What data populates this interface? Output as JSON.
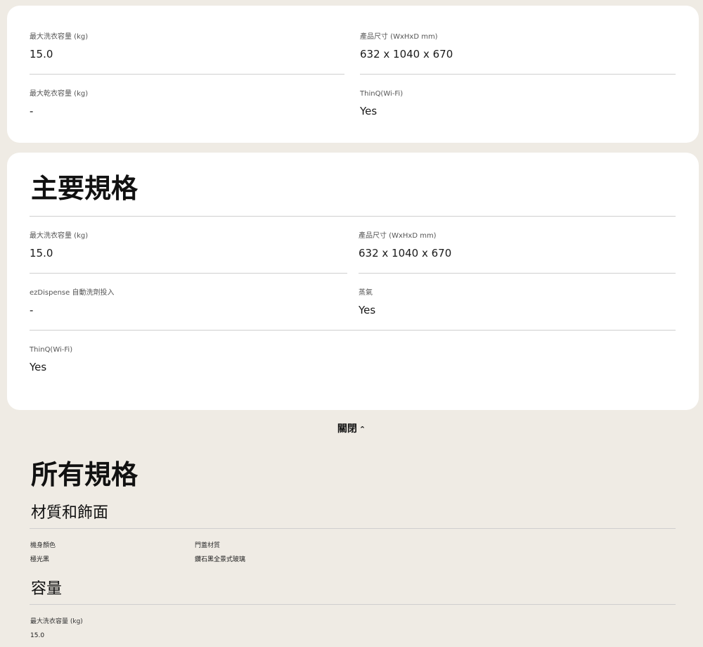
{
  "summary": {
    "max_wash_label": "最大洗衣容量 (kg)",
    "max_wash_value": "15.0",
    "size_label": "產品尺寸 (WxHxD mm)",
    "size_value": "632 x 1040 x 670",
    "max_dry_label": "最大乾衣容量 (kg)",
    "max_dry_value": "-",
    "thinq_label": "ThinQ(Wi-Fi)",
    "thinq_value": "Yes"
  },
  "key_specs": {
    "title": "主要規格",
    "max_wash_label": "最大洗衣容量 (kg)",
    "max_wash_value": "15.0",
    "size_label": "產品尺寸 (WxHxD mm)",
    "size_value": "632 x 1040 x 670",
    "ezdispense_label": "ezDispense 自動洗劑投入",
    "ezdispense_value": "-",
    "steam_label": "蒸氣",
    "steam_value": "Yes",
    "thinq_label": "ThinQ(Wi-Fi)",
    "thinq_value": "Yes"
  },
  "toggle": {
    "label": "關閉",
    "icon": "chevron-up-icon"
  },
  "all_specs": {
    "title": "所有規格",
    "material_section": {
      "heading": "材質和飾面",
      "body_color_label": "機身顏色",
      "body_color_value": "極光黑",
      "door_material_label": "門蓋材質",
      "door_material_value": "鑽石黑全景式玻璃"
    },
    "capacity_section": {
      "heading": "容量",
      "max_wash_label": "最大洗衣容量 (kg)",
      "max_wash_value": "15.0"
    }
  }
}
